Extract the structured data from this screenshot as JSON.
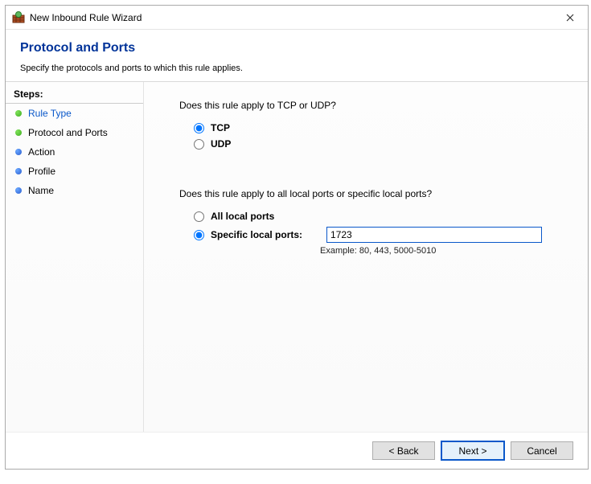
{
  "window": {
    "title": "New Inbound Rule Wizard"
  },
  "header": {
    "heading": "Protocol and Ports",
    "subtitle": "Specify the protocols and ports to which this rule applies."
  },
  "sidebar": {
    "steps_label": "Steps:",
    "items": [
      {
        "label": "Rule Type",
        "state": "done"
      },
      {
        "label": "Protocol and Ports",
        "state": "current"
      },
      {
        "label": "Action",
        "state": "pending"
      },
      {
        "label": "Profile",
        "state": "pending"
      },
      {
        "label": "Name",
        "state": "pending"
      }
    ]
  },
  "content": {
    "question1": "Does this rule apply to TCP or UDP?",
    "radio_tcp": "TCP",
    "radio_udp": "UDP",
    "question2": "Does this rule apply to all local ports or specific local ports?",
    "radio_all_ports": "All local ports",
    "radio_specific_ports": "Specific local ports:",
    "port_value": "1723",
    "example": "Example: 80, 443, 5000-5010"
  },
  "footer": {
    "back": "< Back",
    "next": "Next >",
    "cancel": "Cancel"
  }
}
